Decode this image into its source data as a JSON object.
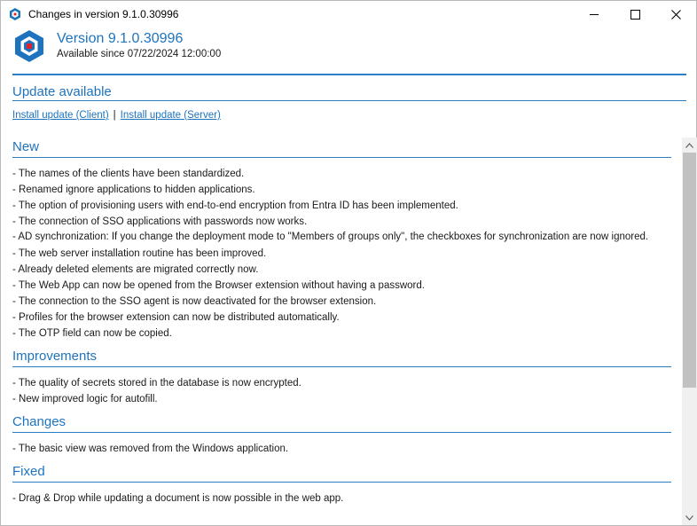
{
  "window": {
    "title": "Changes in version 9.1.0.30996",
    "buttons": {
      "minimize": "minimize-icon",
      "maximize": "maximize-icon",
      "close": "close-icon"
    }
  },
  "header": {
    "version": "Version 9.1.0.30996",
    "available": "Available since 07/22/2024 12:00:00",
    "logo_color": "#1e73be",
    "logo_accent": "#e0202a"
  },
  "update": {
    "heading": "Update available",
    "client_link": "Install update (Client)",
    "separator": "|",
    "server_link": "Install update (Server)"
  },
  "sections": {
    "new": {
      "heading": "New",
      "items": [
        "- The names of the clients have been standardized.",
        "- Renamed ignore applications to hidden applications.",
        "- The option of provisioning users with end-to-end encryption from Entra ID has been implemented.",
        "- The connection of SSO applications with passwords now works.",
        "- AD synchronization: If you change the deployment mode to \"Members of groups only\", the checkboxes for synchronization are now ignored.",
        "- The web server installation routine has been improved.",
        "- Already deleted elements are migrated correctly now.",
        "- The Web App can now be opened from the Browser extension without having a password.",
        "- The connection to the SSO agent is now deactivated for the browser extension.",
        "- Profiles for the browser extension can now be distributed automatically.",
        "- The OTP field can now be copied."
      ]
    },
    "improvements": {
      "heading": "Improvements",
      "items": [
        "- The quality of secrets stored in the database is now encrypted.",
        "- New improved logic for autofill."
      ]
    },
    "changes": {
      "heading": "Changes",
      "items": [
        "- The basic view was removed from the Windows application."
      ]
    },
    "fixed": {
      "heading": "Fixed",
      "items": [
        "- Drag & Drop while updating a document is now possible in the web app."
      ]
    }
  },
  "scrollbar": {
    "position_fraction": 0.0,
    "visible_fraction": 0.61
  }
}
